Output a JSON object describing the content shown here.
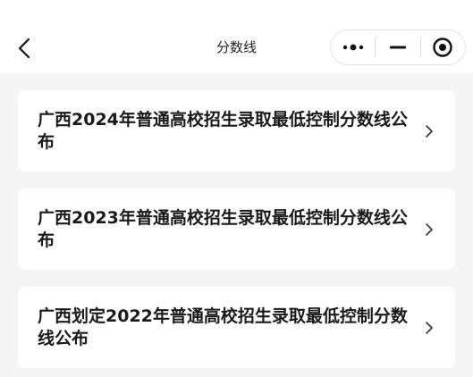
{
  "nav": {
    "title": "分数线",
    "back_icon": "chevron-left-icon",
    "capsule_icons": [
      "more-dots-icon",
      "minimize-icon",
      "target-close-icon"
    ]
  },
  "items": [
    {
      "title": "广西2024年普通高校招生录取最低控制分数线公布"
    },
    {
      "title": "广西2023年普通高校招生录取最低控制分数线公布"
    },
    {
      "title": "广西划定2022年普通高校招生录取最低控制分数线公布"
    }
  ]
}
